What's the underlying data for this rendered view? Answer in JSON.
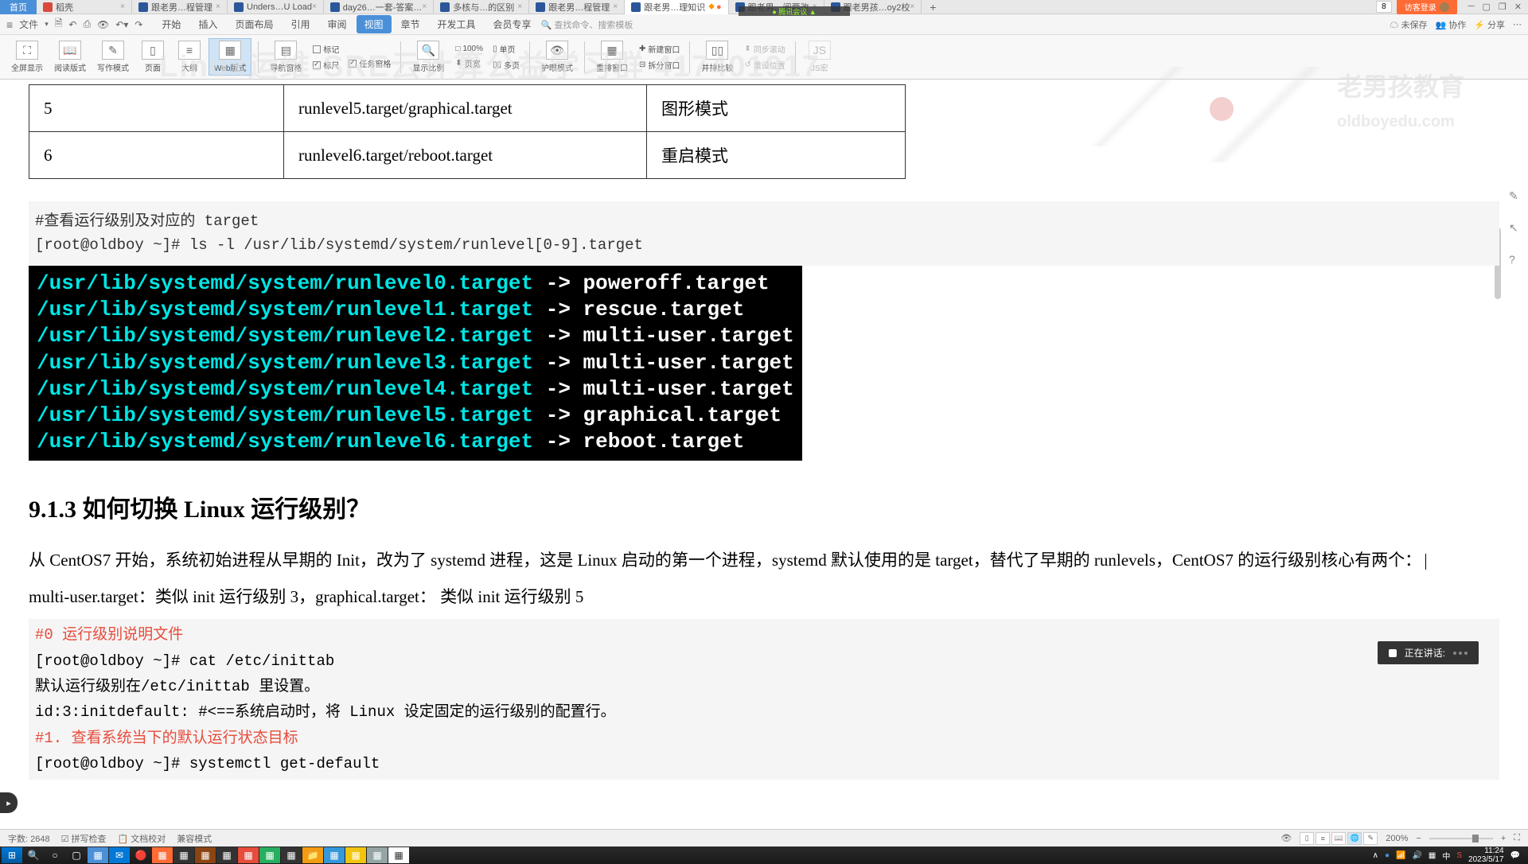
{
  "tabs": {
    "home": "首页",
    "items": [
      {
        "icon": "wps",
        "label": "稻壳",
        "active": false
      },
      {
        "icon": "word",
        "label": "跟老男…程管理",
        "active": false
      },
      {
        "icon": "word",
        "label": "Unders…U Load",
        "active": false
      },
      {
        "icon": "word",
        "label": "day26…一套-答案…",
        "active": false
      },
      {
        "icon": "word",
        "label": "多核与…的区别",
        "active": false
      },
      {
        "icon": "word",
        "label": "跟老男…程管理",
        "active": false
      },
      {
        "icon": "word",
        "label": "跟老男…理知识",
        "active": true
      },
      {
        "icon": "word",
        "label": "跟老男…阅要改",
        "active": false
      },
      {
        "icon": "word",
        "label": "跟老男孩…oy2校",
        "active": false
      }
    ],
    "count": "8",
    "login": "访客登录"
  },
  "tencent_overlay": "● 腾讯会议 ▲",
  "menu": {
    "file": "文件",
    "items": [
      "开始",
      "插入",
      "页面布局",
      "引用",
      "审阅",
      "视图",
      "章节",
      "开发工具",
      "会员专享"
    ],
    "active": "视图",
    "search_placeholder": "查找命令、搜索模板",
    "right": [
      "未保存",
      "协作",
      "分享"
    ]
  },
  "toolbar": {
    "view_modes": [
      "全屏显示",
      "阅读版式",
      "写作模式",
      "页面",
      "大纲",
      "Web版式"
    ],
    "selected_mode": "Web版式",
    "nav_group": "导航窗格",
    "markup": "标记",
    "check_ruler": "标尺",
    "check_task": "任务窗格",
    "zoom_btn": "显示比例",
    "zoom_val": "100%",
    "page_group": [
      "单页",
      "多页",
      "页宽"
    ],
    "eye": "护眼模式",
    "arrange": [
      "重排窗口",
      "新建窗口",
      "拆分窗口"
    ],
    "compare": "并排比较",
    "sync_scroll": "同步滚动",
    "reset": "重设位置",
    "macro": "JS宏"
  },
  "watermark": {
    "text": "Linux运维-SRE云计算公益学习群 417401917",
    "logo1": "老男孩教育",
    "logo2": "oldboyedu.com"
  },
  "table": {
    "row1": {
      "c1": "5",
      "c2": "runlevel5.target/graphical.target",
      "c3": "图形模式"
    },
    "row2": {
      "c1": "6",
      "c2": "runlevel6.target/reboot.target",
      "c3": "重启模式"
    }
  },
  "code1": {
    "line1": "#查看运行级别及对应的 target",
    "line2": "[root@oldboy ~]# ls -l /usr/lib/systemd/system/runlevel[0-9].target"
  },
  "terminal": [
    {
      "path": "/usr/lib/systemd/system/runlevel0.target",
      "dest": " -> poweroff.target"
    },
    {
      "path": "/usr/lib/systemd/system/runlevel1.target",
      "dest": " -> rescue.target"
    },
    {
      "path": "/usr/lib/systemd/system/runlevel2.target",
      "dest": " -> multi-user.target"
    },
    {
      "path": "/usr/lib/systemd/system/runlevel3.target",
      "dest": " -> multi-user.target"
    },
    {
      "path": "/usr/lib/systemd/system/runlevel4.target",
      "dest": " -> multi-user.target"
    },
    {
      "path": "/usr/lib/systemd/system/runlevel5.target",
      "dest": " -> graphical.target"
    },
    {
      "path": "/usr/lib/systemd/system/runlevel6.target",
      "dest": " -> reboot.target"
    }
  ],
  "heading": "9.1.3  如何切换 Linux 运行级别？",
  "para1": "从 CentOS7 开始，系统初始进程从早期的 Init，改为了 systemd 进程，这是 Linux 启动的第一个进程，systemd 默认使用的是 target，替代了早期的 runlevels，CentOS7 的运行级别核心有两个：",
  "para2": "multi-user.target：类似 init 运行级别 3，graphical.target：  类似 init 运行级别 5",
  "code2": {
    "l1": "#0 运行级别说明文件",
    "l2": "[root@oldboy ~]# cat /etc/inittab",
    "l3": "默认运行级别在/etc/inittab 里设置。",
    "l4": "id:3:initdefault:  #<==系统启动时，将 Linux 设定固定的运行级别的配置行。",
    "l5": "#1. 查看系统当下的默认运行状态目标",
    "l6": "[root@oldboy ~]# systemctl get-default"
  },
  "speaking": "正在讲话:",
  "status": {
    "words": "字数: 2648",
    "spell": "拼写检查",
    "doc_check": "文档校对",
    "compat": "兼容模式",
    "zoom": "200%"
  },
  "taskbar_time": "11:24",
  "taskbar_date": "2023/5/17"
}
